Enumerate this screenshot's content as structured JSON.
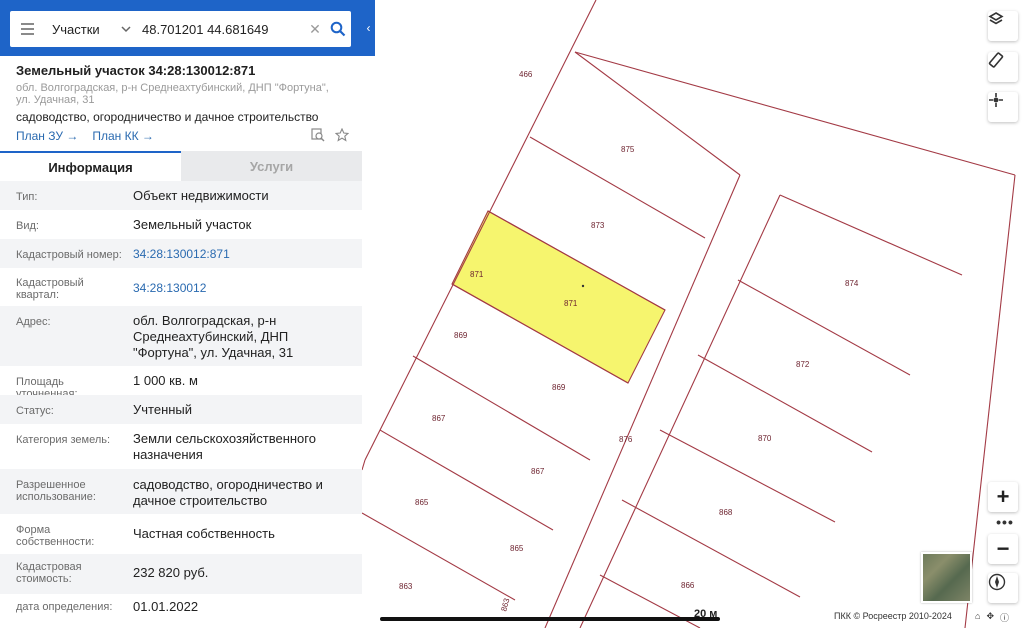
{
  "search": {
    "category": "Участки",
    "query": "48.701201 44.681649"
  },
  "object": {
    "title": "Земельный участок 34:28:130012:871",
    "address_sub": "обл. Волгоградская, р-н Среднеахтубинский, ДНП \"Фортуна\", ул. Удачная, 31",
    "usage": "садоводство, огородничество и дачное строительство",
    "plan_zu": "План ЗУ",
    "plan_kk": "План КК"
  },
  "tabs": {
    "info": "Информация",
    "services": "Услуги"
  },
  "info": [
    {
      "label": "Тип:",
      "value": "Объект недвижимости"
    },
    {
      "label": "Вид:",
      "value": "Земельный участок"
    },
    {
      "label": "Кадастровый номер:",
      "value": "34:28:130012:871"
    },
    {
      "label": "Кадастровый квартал:",
      "value": "34:28:130012"
    },
    {
      "label": "Адрес:",
      "value": "обл. Волгоградская, р-н Среднеахтубинский, ДНП \"Фортуна\", ул. Удачная, 31"
    },
    {
      "label": "Площадь уточненная:",
      "value": "1 000 кв. м"
    },
    {
      "label": "Статус:",
      "value": "Учтенный"
    },
    {
      "label": "Категория земель:",
      "value": "Земли сельскохозяйственного назначения"
    },
    {
      "label": "Разрешенное использование:",
      "value": "садоводство, огородничество и дачное строительство"
    },
    {
      "label": "Форма собственности:",
      "value": "Частная собственность"
    },
    {
      "label": "Кадастровая стоимость:",
      "value": "232 820 руб."
    },
    {
      "label": "дата определения:",
      "value": "01.01.2022"
    }
  ],
  "map": {
    "parcels": [
      "466",
      "875",
      "873",
      "871",
      "871",
      "874",
      "872",
      "869",
      "869",
      "870",
      "867",
      "867",
      "876",
      "868",
      "865",
      "865",
      "866",
      "863",
      "863"
    ],
    "scale_label": "20 м",
    "copyright": "ПКК © Росреестр 2010-2024",
    "zoom_in": "+",
    "zoom_out": "−",
    "zoom_more": "•••"
  },
  "colors": {
    "brand_blue": "#1e64c8",
    "parcel_line": "#a33a45",
    "selected_fill": "#f6f56e",
    "link": "#2a6ab0"
  },
  "icons": [
    "menu-icon",
    "chevron-down-icon",
    "clear-icon",
    "search-icon",
    "collapse-panel-icon",
    "search-plan-icon",
    "star-icon",
    "layers-icon",
    "ruler-icon",
    "locate-icon",
    "compass-icon",
    "home-icon"
  ]
}
